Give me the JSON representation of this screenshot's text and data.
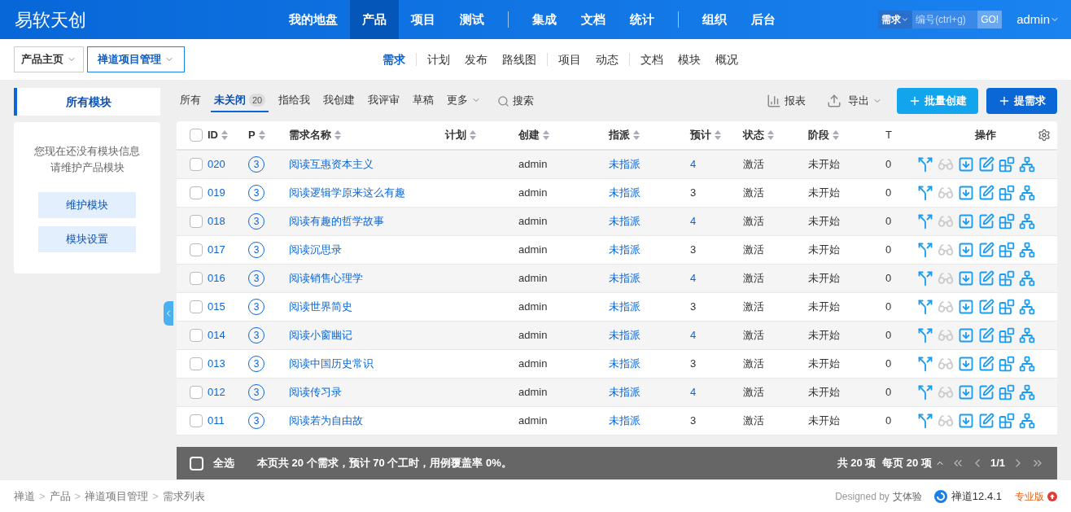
{
  "brand": "易软天创",
  "main_nav": [
    {
      "label": "我的地盘",
      "selected": false,
      "separator_before": false
    },
    {
      "label": "产品",
      "selected": true,
      "separator_before": false
    },
    {
      "label": "项目",
      "selected": false,
      "separator_before": false
    },
    {
      "label": "测试",
      "selected": false,
      "separator_before": false
    },
    {
      "label": "集成",
      "selected": false,
      "separator_before": true
    },
    {
      "label": "文档",
      "selected": false,
      "separator_before": false
    },
    {
      "label": "统计",
      "selected": false,
      "separator_before": false
    },
    {
      "label": "组织",
      "selected": false,
      "separator_before": true
    },
    {
      "label": "后台",
      "selected": false,
      "separator_before": false
    }
  ],
  "quick_search": {
    "type_label": "需求",
    "placeholder": "编号(ctrl+g)",
    "go": "GO!"
  },
  "user": "admin",
  "product_crumbs": [
    "产品主页",
    "禅道项目管理"
  ],
  "sub_nav": [
    {
      "label": "需求",
      "selected": true,
      "separator_before": false
    },
    {
      "label": "计划",
      "selected": false,
      "separator_before": true
    },
    {
      "label": "发布",
      "selected": false,
      "separator_before": false
    },
    {
      "label": "路线图",
      "selected": false,
      "separator_before": false
    },
    {
      "label": "项目",
      "selected": false,
      "separator_before": true
    },
    {
      "label": "动态",
      "selected": false,
      "separator_before": false
    },
    {
      "label": "文档",
      "selected": false,
      "separator_before": true
    },
    {
      "label": "模块",
      "selected": false,
      "separator_before": false
    },
    {
      "label": "概况",
      "selected": false,
      "separator_before": false
    }
  ],
  "sidebar": {
    "title": "所有模块",
    "message": [
      "您现在还没有模块信息",
      "请维护产品模块"
    ],
    "buttons": [
      "维护模块",
      "模块设置"
    ]
  },
  "filters": [
    {
      "label": "所有",
      "selected": false
    },
    {
      "label": "未关闭",
      "selected": true,
      "count": "20"
    },
    {
      "label": "指给我",
      "selected": false
    },
    {
      "label": "我创建",
      "selected": false
    },
    {
      "label": "我评审",
      "selected": false
    },
    {
      "label": "草稿",
      "selected": false
    },
    {
      "label": "更多",
      "selected": false,
      "dropdown": true
    }
  ],
  "search_label": "搜索",
  "toolbar": {
    "report": "报表",
    "export": "导出",
    "batch_create": "批量创建",
    "create": "提需求"
  },
  "table": {
    "columns": [
      "ID",
      "P",
      "需求名称",
      "计划",
      "创建",
      "指派",
      "预计",
      "状态",
      "阶段",
      "T",
      "操作"
    ],
    "all_checked": false,
    "row_actions": [
      {
        "kind": "change",
        "disabled": false
      },
      {
        "kind": "review",
        "disabled": true
      },
      {
        "kind": "close",
        "disabled": false
      },
      {
        "kind": "edit",
        "disabled": false
      },
      {
        "kind": "testcase",
        "disabled": false
      },
      {
        "kind": "subdivide",
        "disabled": false
      }
    ],
    "rows": [
      {
        "id": "020",
        "priority": "3",
        "name": "阅读互惠资本主义",
        "creator": "admin",
        "assigned": "未指派",
        "estimate": "4",
        "status": "激活",
        "stage": "未开始",
        "t": "0",
        "highlighted": true,
        "checked": false
      },
      {
        "id": "019",
        "priority": "3",
        "name": "阅读逻辑学原来这么有趣",
        "creator": "admin",
        "assigned": "未指派",
        "estimate": "3",
        "status": "激活",
        "stage": "未开始",
        "t": "0",
        "highlighted": false,
        "checked": false
      },
      {
        "id": "018",
        "priority": "3",
        "name": "阅读有趣的哲学故事",
        "creator": "admin",
        "assigned": "未指派",
        "estimate": "4",
        "status": "激活",
        "stage": "未开始",
        "t": "0",
        "highlighted": true,
        "checked": false
      },
      {
        "id": "017",
        "priority": "3",
        "name": "阅读沉思录",
        "creator": "admin",
        "assigned": "未指派",
        "estimate": "3",
        "status": "激活",
        "stage": "未开始",
        "t": "0",
        "highlighted": false,
        "checked": false
      },
      {
        "id": "016",
        "priority": "3",
        "name": "阅读销售心理学",
        "creator": "admin",
        "assigned": "未指派",
        "estimate": "4",
        "status": "激活",
        "stage": "未开始",
        "t": "0",
        "highlighted": true,
        "checked": false
      },
      {
        "id": "015",
        "priority": "3",
        "name": "阅读世界简史",
        "creator": "admin",
        "assigned": "未指派",
        "estimate": "3",
        "status": "激活",
        "stage": "未开始",
        "t": "0",
        "highlighted": false,
        "checked": false
      },
      {
        "id": "014",
        "priority": "3",
        "name": "阅读小窗幽记",
        "creator": "admin",
        "assigned": "未指派",
        "estimate": "4",
        "status": "激活",
        "stage": "未开始",
        "t": "0",
        "highlighted": true,
        "checked": false
      },
      {
        "id": "013",
        "priority": "3",
        "name": "阅读中国历史常识",
        "creator": "admin",
        "assigned": "未指派",
        "estimate": "3",
        "status": "激活",
        "stage": "未开始",
        "t": "0",
        "highlighted": false,
        "checked": false
      },
      {
        "id": "012",
        "priority": "3",
        "name": "阅读传习录",
        "creator": "admin",
        "assigned": "未指派",
        "estimate": "4",
        "status": "激活",
        "stage": "未开始",
        "t": "0",
        "highlighted": true,
        "checked": false
      },
      {
        "id": "011",
        "priority": "3",
        "name": "阅读若为自由故",
        "creator": "admin",
        "assigned": "未指派",
        "estimate": "3",
        "status": "激活",
        "stage": "未开始",
        "t": "0",
        "highlighted": false,
        "checked": false
      }
    ]
  },
  "table_footer": {
    "select_all": "全选",
    "select_all_checked": false,
    "summary": "本页共 20 个需求，预计 70 个工时，用例覆盖率 0%。",
    "total": "共 20 项",
    "per_page": "每页 20 项",
    "page": "1/1"
  },
  "breadcrumb": [
    "禅道",
    "产品",
    "禅道项目管理",
    "需求列表"
  ],
  "breadcrumb_separator": ">",
  "footer": {
    "designed_by": "Designed by",
    "designer": "艾体验",
    "version": "禅道12.4.1",
    "edition": "专业版"
  }
}
